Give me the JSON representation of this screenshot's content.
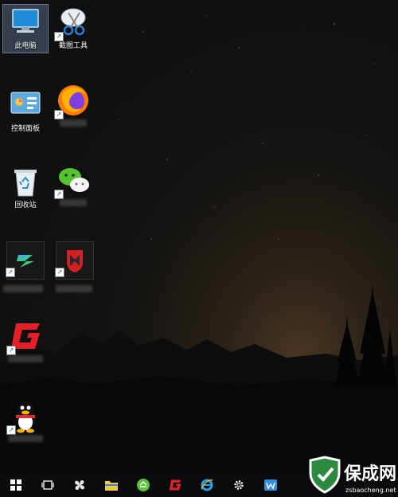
{
  "desktop": {
    "icons": [
      {
        "label": "此电脑"
      },
      {
        "label": "截图工具"
      },
      {
        "label": "控制面板"
      },
      {
        "label": ""
      },
      {
        "label": "回收站"
      },
      {
        "label": ""
      }
    ]
  },
  "watermark": {
    "brand": "保成网",
    "url": "zsbaocheng.net"
  },
  "colors": {
    "accent": "#2b8a3e",
    "selection": "#7896be"
  }
}
